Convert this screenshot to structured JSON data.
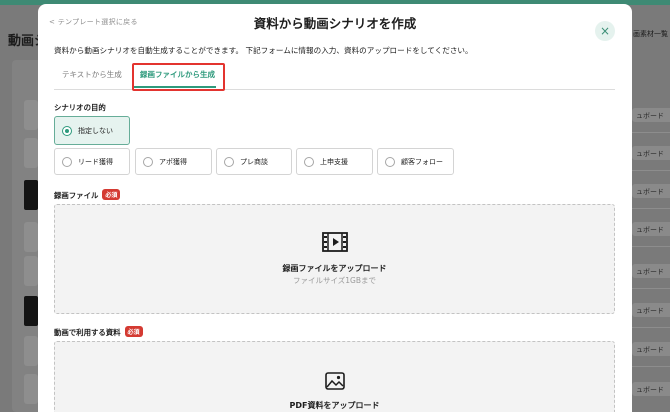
{
  "background": {
    "page_title": "動画シ",
    "right_top_label": "画素材一覧",
    "right_items": [
      "ュボード",
      "ュボード",
      "ュボード",
      "ュボード",
      "ュボード",
      "ュボード",
      "ュボード",
      "ュボード",
      "ュボード",
      "ュボード"
    ]
  },
  "modal": {
    "back_link": "< テンプレート選択に戻る",
    "title": "資料から動画シナリオを作成",
    "close_icon": "×",
    "intro": "資料から動画シナリオを自動生成することができます。 下記フォームに情報の入力、資料のアップロードをしてください。"
  },
  "tabs": [
    {
      "label": "テキストから生成",
      "active": false
    },
    {
      "label": "録画ファイルから生成",
      "active": true
    }
  ],
  "purpose": {
    "label": "シナリオの目的",
    "options": [
      {
        "label": "指定しない",
        "selected": true
      },
      {
        "label": "リード獲得",
        "selected": false
      },
      {
        "label": "アポ獲得",
        "selected": false
      },
      {
        "label": "プレ商談",
        "selected": false
      },
      {
        "label": "上申支援",
        "selected": false
      },
      {
        "label": "顧客フォロー",
        "selected": false
      }
    ]
  },
  "recording": {
    "label": "録画ファイル",
    "required_badge": "必須",
    "upload_text": "録画ファイルをアップロード",
    "size_limit": "ファイルサイズ1GBまで",
    "icon": "film-icon"
  },
  "materials": {
    "label": "動画で利用する資料",
    "required_badge": "必須",
    "upload_text": "PDF資料をアップロード",
    "icon": "image-icon"
  },
  "colors": {
    "accent": "#2e9a7c",
    "highlight": "#e3342f",
    "required": "#d43a32"
  }
}
